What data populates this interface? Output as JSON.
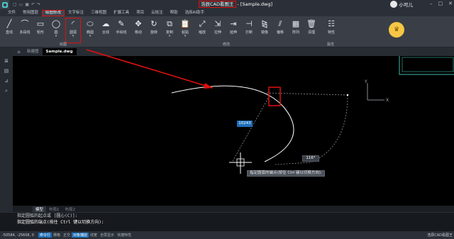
{
  "titlebar": {
    "product": "浩辰CAD看图王",
    "file": "- [Sample.dwg]",
    "user_name": "小可儿"
  },
  "menubar": {
    "items": [
      "文件",
      "常用图层",
      "绘图修改",
      "文字标注",
      "三维视图",
      "扩展工具",
      "项目",
      "云批注",
      "帮助",
      "浩辰AI助手"
    ]
  },
  "ribbon": {
    "draw_tools": [
      "直线",
      "多段线",
      "矩形",
      "圆",
      "圆弧",
      "椭圆",
      "云线",
      "手绘线"
    ],
    "modify_tools": [
      "移动",
      "旋转",
      "复制",
      "粘贴",
      "缩放",
      "拉伸",
      "延伸",
      "打断",
      "镜像",
      "偏移",
      "阵列",
      "清理",
      "特性"
    ],
    "group_draw": "绘图",
    "group_modify": "修改",
    "group_props": "属性"
  },
  "doc_tabs": {
    "tabs": [
      "新建图",
      "Sample.dwg"
    ]
  },
  "canvas": {
    "dyn_input_value": "10243",
    "angle_value": "116°",
    "tooltip": "指定圆弧的端点(按住 Ctrl 键以切换方向):"
  },
  "layout_tabs": [
    "模型",
    "布局1",
    "布局2"
  ],
  "command_lines": [
    "指定圆弧的起点或 [圆心(C)]:",
    "指定圆弧的端点(按住 Ctrl 键以切换方向):"
  ],
  "status": {
    "coords": "-50584, -25608, 0",
    "toggles": [
      "命令行",
      "栅格",
      "正交",
      "对象捕捉",
      "线宽",
      "全屏显示",
      "快捷特性"
    ],
    "app_name": "浩辰CAD看图王"
  },
  "colors": {
    "highlight": "#e01010",
    "accent": "#1d6fb8"
  }
}
